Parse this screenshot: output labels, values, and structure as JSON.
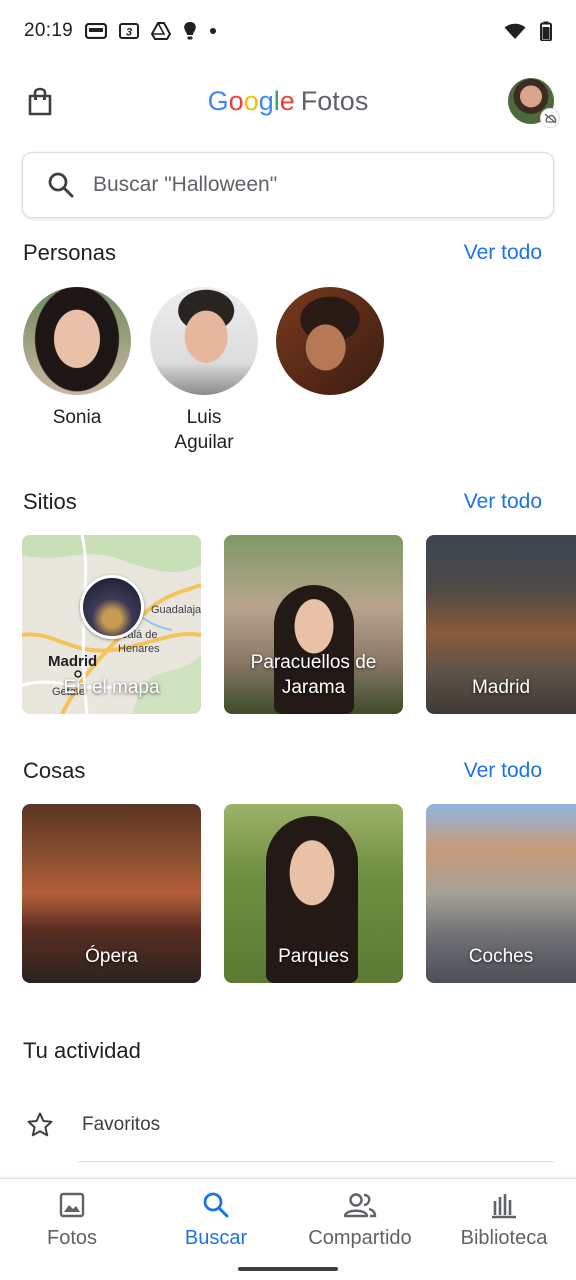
{
  "status_bar": {
    "time": "20:19",
    "icons": [
      "card-icon",
      "3-icon",
      "drive-icon",
      "bulb-icon",
      "dot-icon",
      "wifi-icon",
      "battery-icon"
    ]
  },
  "app_bar": {
    "logo_google": [
      "G",
      "o",
      "o",
      "g",
      "l",
      "e"
    ],
    "logo_product": "Fotos",
    "logo_colors": [
      "#4285F4",
      "#EA4335",
      "#FBBC05",
      "#4285F4",
      "#34A853",
      "#EA4335"
    ]
  },
  "search": {
    "placeholder": "Buscar \"Halloween\""
  },
  "people": {
    "title": "Personas",
    "see_all": "Ver todo",
    "items": [
      {
        "name": "Sonia"
      },
      {
        "name": "Luis\nAguilar"
      },
      {
        "name": ""
      }
    ]
  },
  "places": {
    "title": "Sitios",
    "see_all": "Ver todo",
    "map_labels": {
      "madrid": "Madrid",
      "guadalajara": "Guadalaja",
      "alcala": "calá de",
      "henares": "Henares",
      "getafe": "Getafe"
    },
    "items": [
      {
        "label": "En el mapa"
      },
      {
        "label": "Paracuellos de Jarama"
      },
      {
        "label": "Madrid"
      }
    ]
  },
  "things": {
    "title": "Cosas",
    "see_all": "Ver todo",
    "items": [
      {
        "label": "Ópera"
      },
      {
        "label": "Parques"
      },
      {
        "label": "Coches"
      }
    ]
  },
  "activity": {
    "title": "Tu actividad",
    "items": [
      {
        "label": "Favoritos",
        "icon": "star-icon"
      }
    ]
  },
  "bottom_nav": {
    "accent": "#1a73e8",
    "items": [
      {
        "label": "Fotos",
        "icon": "photo-icon",
        "active": false
      },
      {
        "label": "Buscar",
        "icon": "search-icon",
        "active": true
      },
      {
        "label": "Compartido",
        "icon": "people-icon",
        "active": false
      },
      {
        "label": "Biblioteca",
        "icon": "library-icon",
        "active": false
      }
    ]
  }
}
